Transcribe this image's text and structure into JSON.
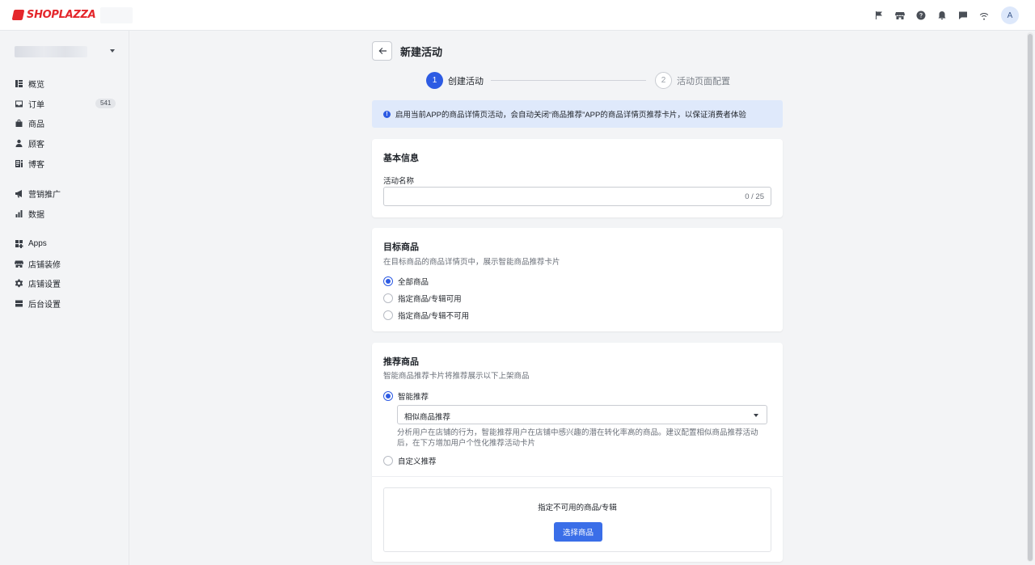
{
  "brand": {
    "name": "SHOPLAZZA"
  },
  "topbar": {
    "avatar_letter": "A",
    "icons": [
      "flag-icon",
      "store-icon",
      "help-icon",
      "bell-icon",
      "message-icon",
      "wifi-icon"
    ]
  },
  "sidebar": {
    "group1": [
      {
        "label": "概览",
        "icon": "overview-icon"
      },
      {
        "label": "订单",
        "icon": "inbox-icon",
        "badge": "541"
      },
      {
        "label": "商品",
        "icon": "bag-icon"
      },
      {
        "label": "顾客",
        "icon": "person-icon"
      },
      {
        "label": "博客",
        "icon": "blog-icon"
      }
    ],
    "group2": [
      {
        "label": "营销推广",
        "icon": "megaphone-icon"
      },
      {
        "label": "数据",
        "icon": "bar-chart-icon"
      }
    ],
    "group3": [
      {
        "label": "Apps",
        "icon": "apps-icon"
      },
      {
        "label": "店铺装修",
        "icon": "storefront-icon"
      },
      {
        "label": "店铺设置",
        "icon": "gear-icon"
      },
      {
        "label": "后台设置",
        "icon": "server-icon"
      }
    ]
  },
  "page": {
    "title": "新建活动"
  },
  "steps": [
    {
      "number": "1",
      "label": "创建活动"
    },
    {
      "number": "2",
      "label": "活动页面配置"
    }
  ],
  "alert": {
    "text": "启用当前APP的商品详情页活动，会自动关闭“商品推荐”APP的商品详情页推荐卡片，以保证消费者体验"
  },
  "basic_info": {
    "title": "基本信息",
    "name_label": "活动名称",
    "name_value": "",
    "counter": "0 / 25"
  },
  "target_products": {
    "title": "目标商品",
    "subtitle": "在目标商品的商品详情页中，展示智能商品推荐卡片",
    "options": [
      {
        "label": "全部商品",
        "selected": true
      },
      {
        "label": "指定商品/专辑可用",
        "selected": false
      },
      {
        "label": "指定商品/专辑不可用",
        "selected": false
      }
    ]
  },
  "recommend_products": {
    "title": "推荐商品",
    "subtitle": "智能商品推荐卡片将推荐展示以下上架商品",
    "smart_label": "智能推荐",
    "select_value": "相似商品推荐",
    "hint": "分析用户在店铺的行为，智能推荐用户在店铺中感兴趣的潜在转化率高的商品。建议配置相似商品推荐活动后，在下方增加用户个性化推荐活动卡片",
    "custom_label": "自定义推荐",
    "excluded_title": "指定不可用的商品/专辑",
    "select_button": "选择商品"
  },
  "colors": {
    "primary": "#2d5be3",
    "brand": "#e4262b",
    "alert_bg": "#dfe9fb"
  }
}
